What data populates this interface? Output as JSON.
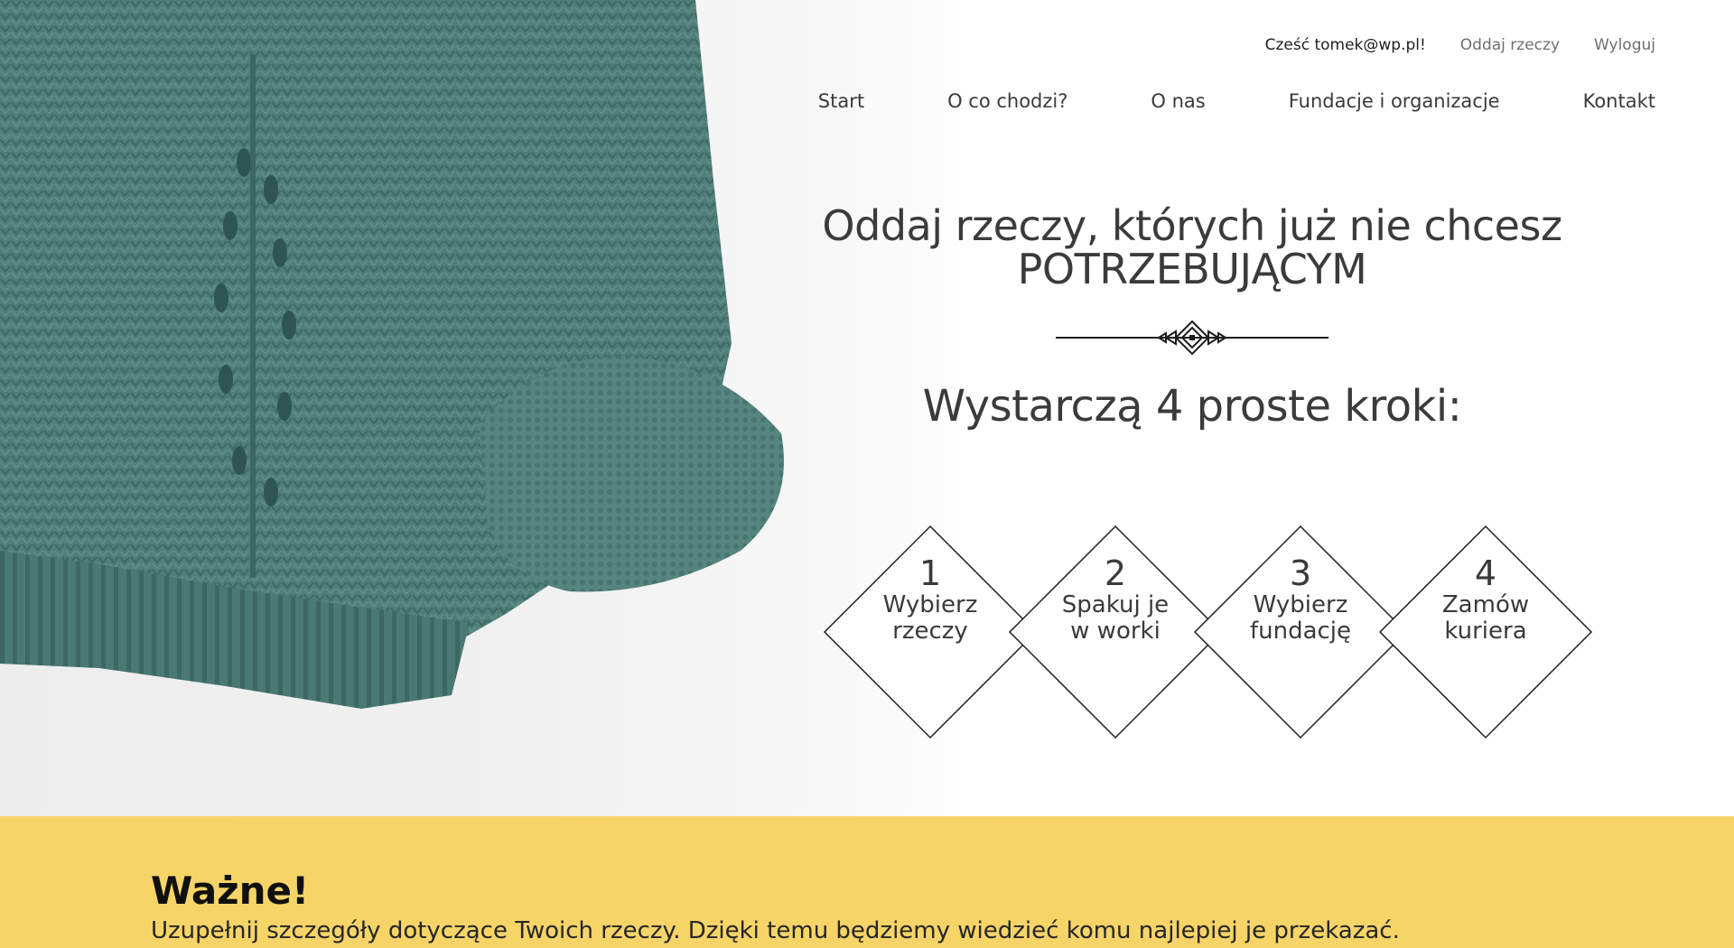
{
  "user_bar": {
    "greeting": "Cześć tomek@wp.pl!",
    "give_link": "Oddaj rzeczy",
    "logout_link": "Wyloguj"
  },
  "nav": {
    "items": [
      {
        "label": "Start"
      },
      {
        "label": "O co chodzi?"
      },
      {
        "label": "O nas"
      },
      {
        "label": "Fundacje i organizacje"
      },
      {
        "label": "Kontakt"
      }
    ]
  },
  "hero": {
    "title_line1": "Oddaj rzeczy, których już nie chcesz",
    "title_line2": "POTRZEBUJĄCYM",
    "subtitle": "Wystarczą 4 proste kroki:"
  },
  "steps": [
    {
      "number": "1",
      "line1": "Wybierz",
      "line2": "rzeczy"
    },
    {
      "number": "2",
      "line1": "Spakuj je",
      "line2": "w worki"
    },
    {
      "number": "3",
      "line1": "Wybierz",
      "line2": "fundację"
    },
    {
      "number": "4",
      "line1": "Zamów",
      "line2": "kuriera"
    }
  ],
  "important": {
    "title": "Ważne!",
    "text": "Uzupełnij szczegóły dotyczące Twoich rzeczy. Dzięki temu będziemy wiedzieć komu najlepiej je przekazać."
  },
  "colors": {
    "sweater": "#4f7f78",
    "banner": "#f6d468",
    "text": "#3b3b3b"
  },
  "icons": [
    "decorative-divider-icon"
  ]
}
